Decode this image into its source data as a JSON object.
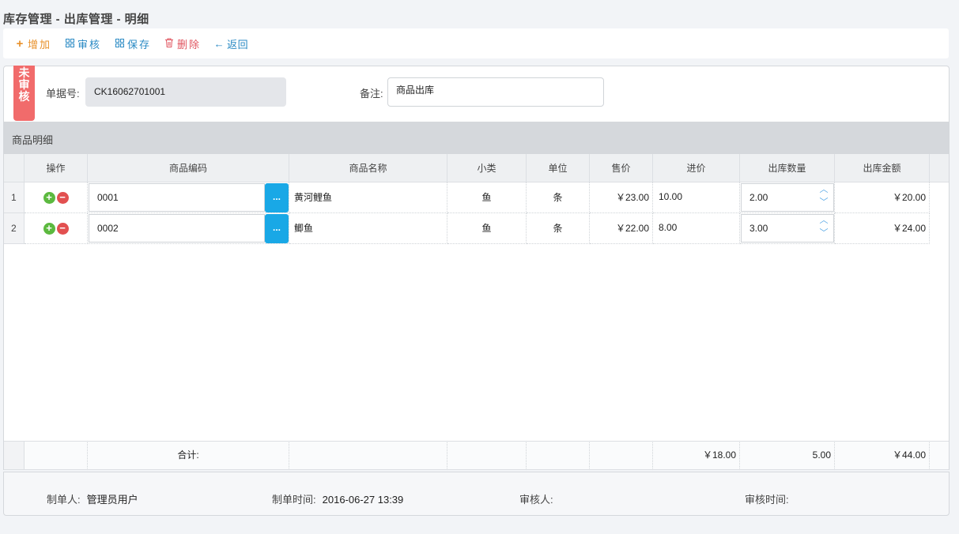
{
  "page_title": "库存管理 - 出库管理 - 明细",
  "toolbar": {
    "add": "增加",
    "audit": "审核",
    "save": "保存",
    "delete": "删除",
    "back": "返回"
  },
  "status_badge": "未审核",
  "form": {
    "doc_no_label": "单据号:",
    "doc_no_value": "CK16062701001",
    "remark_label": "备注:",
    "remark_value": "商品出库"
  },
  "section_title": "商品明细",
  "table": {
    "headers": [
      "操作",
      "商品编码",
      "商品名称",
      "小类",
      "单位",
      "售价",
      "进价",
      "出库数量",
      "出库金额"
    ],
    "rows": [
      {
        "num": "1",
        "code": "0001",
        "name": "黄河鲤鱼",
        "category": "鱼",
        "unit": "条",
        "sale_price": "￥23.00",
        "cost_price": "10.00",
        "qty": "2.00",
        "amount": "￥20.00"
      },
      {
        "num": "2",
        "code": "0002",
        "name": "鲫鱼",
        "category": "鱼",
        "unit": "条",
        "sale_price": "￥22.00",
        "cost_price": "8.00",
        "qty": "3.00",
        "amount": "￥24.00"
      }
    ],
    "pick_label": "...",
    "totals": {
      "label": "合计:",
      "cost_total": "￥18.00",
      "qty_total": "5.00",
      "amount_total": "￥44.00"
    }
  },
  "meta": {
    "creator_label": "制单人:",
    "creator_value": "管理员用户",
    "created_label": "制单时间:",
    "created_value": "2016-06-27 13:39",
    "auditor_label": "审核人:",
    "audit_time_label": "审核时间:"
  }
}
